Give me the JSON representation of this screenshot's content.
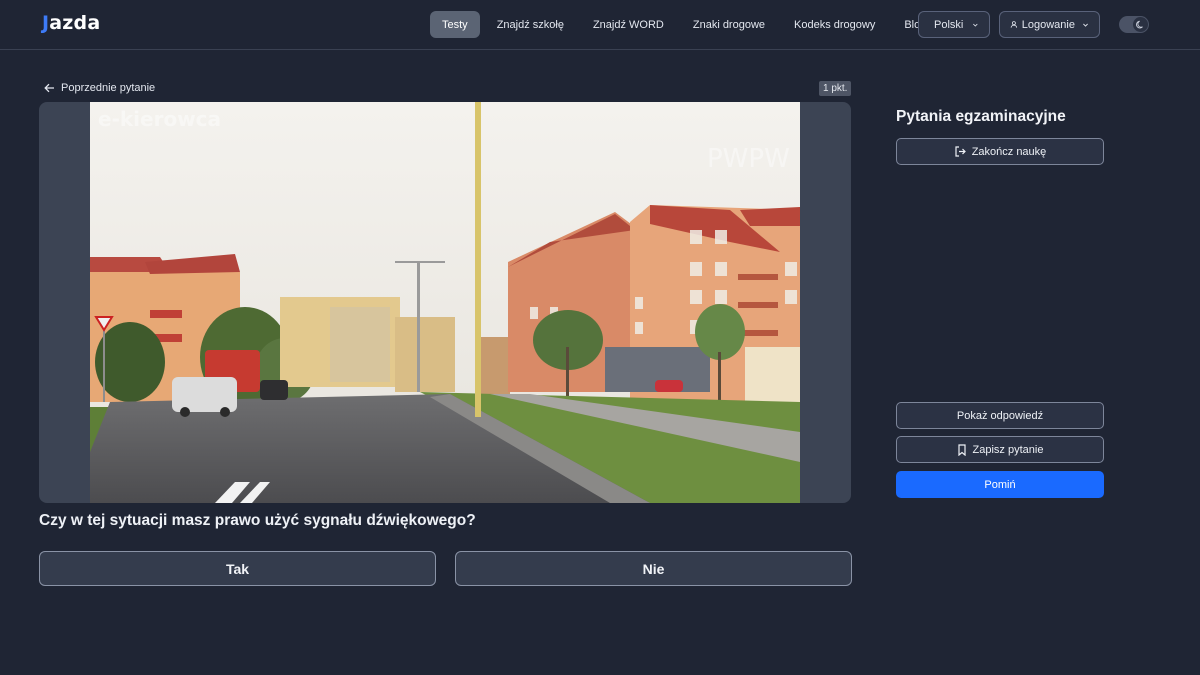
{
  "header": {
    "logo": {
      "mark": "J",
      "text": "azda"
    },
    "nav": [
      {
        "label": "Testy",
        "active": true
      },
      {
        "label": "Znajdź szkołę",
        "active": false
      },
      {
        "label": "Znajdź WORD",
        "active": false
      },
      {
        "label": "Znaki drogowe",
        "active": false
      },
      {
        "label": "Kodeks drogowy",
        "active": false
      },
      {
        "label": "Blog",
        "active": false
      }
    ],
    "language": "Polski",
    "login": "Logowanie",
    "theme_toggle": {
      "mode": "dark",
      "icon": "moon-icon"
    }
  },
  "main": {
    "back_label": "Poprzednie pytanie",
    "points": "1 pkt.",
    "media": {
      "watermark_left": "e-kierowca",
      "watermark_right": "PWPW"
    },
    "question": "Czy w tej sytuacji masz prawo użyć sygnału dźwiękowego?",
    "answers": {
      "yes": "Tak",
      "no": "Nie"
    }
  },
  "sidebar": {
    "title": "Pytania egzaminacyjne",
    "end_label": "Zakończ naukę",
    "show_answer_label": "Pokaż odpowiedź",
    "save_label": "Zapisz pytanie",
    "skip_label": "Pomiń"
  },
  "colors": {
    "background": "#1f2534",
    "accent": "#1a6aff",
    "brand": "#3d7bf7",
    "active_nav": "#5b6474"
  }
}
